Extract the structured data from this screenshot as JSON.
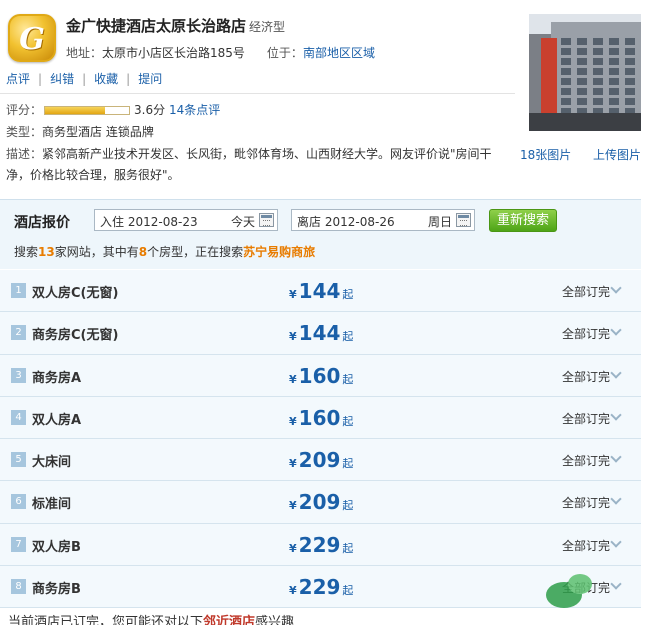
{
  "hotel": {
    "logo_letter": "G",
    "name": "金广快捷酒店太原长治路店",
    "type": "经济型",
    "address_label": "地址：",
    "address": "太原市小店区长治路185号",
    "location_label": "位于：",
    "location": "南部地区区域"
  },
  "actions": [
    "点评",
    "纠错",
    "收藏",
    "提问"
  ],
  "rating": {
    "label": "评分：",
    "score": "3.6分",
    "score_fraction": 0.72,
    "reviews": "14条点评"
  },
  "category": {
    "label": "类型：",
    "value": "商务型酒店 连锁品牌"
  },
  "description": {
    "label": "描述：",
    "text": "紧邻高新产业技术开发区、长风街，毗邻体育场、山西财经大学。网友评价说\"房间干净，价格比较合理，服务很好\"。"
  },
  "photos": {
    "count_link": "18张图片",
    "upload_link": "上传图片"
  },
  "search": {
    "title": "酒店报价",
    "checkin_label": "入住",
    "checkin_date": "2012-08-23",
    "checkin_day": "今天",
    "checkout_label": "离店",
    "checkout_date": "2012-08-26",
    "checkout_day": "周日",
    "button": "重新搜索",
    "status_prefix": "搜索",
    "site_count": "13",
    "status_mid1": "家网站，其中有",
    "room_count": "8",
    "status_mid2": "个房型，正在搜索",
    "current_site": "苏宁易购商旅"
  },
  "rooms": [
    {
      "index": "1",
      "name": "双人房C(无窗)",
      "currency": "¥",
      "price": "144",
      "suffix": "起",
      "status": "全部订完"
    },
    {
      "index": "2",
      "name": "商务房C(无窗)",
      "currency": "¥",
      "price": "144",
      "suffix": "起",
      "status": "全部订完"
    },
    {
      "index": "3",
      "name": "商务房A",
      "currency": "¥",
      "price": "160",
      "suffix": "起",
      "status": "全部订完"
    },
    {
      "index": "4",
      "name": "双人房A",
      "currency": "¥",
      "price": "160",
      "suffix": "起",
      "status": "全部订完"
    },
    {
      "index": "5",
      "name": "大床间",
      "currency": "¥",
      "price": "209",
      "suffix": "起",
      "status": "全部订完"
    },
    {
      "index": "6",
      "name": "标准间",
      "currency": "¥",
      "price": "209",
      "suffix": "起",
      "status": "全部订完"
    },
    {
      "index": "7",
      "name": "双人房B",
      "currency": "¥",
      "price": "229",
      "suffix": "起",
      "status": "全部订完"
    },
    {
      "index": "8",
      "name": "商务房B",
      "currency": "¥",
      "price": "229",
      "suffix": "起",
      "status": "全部订完"
    }
  ],
  "notice": {
    "prefix": "当前酒店已订完，您可能还对以下",
    "highlight": "邻近酒店",
    "suffix": "感兴趣"
  },
  "colors": {
    "link": "#1a5fa8",
    "accent_orange": "#e87c00",
    "button_green": "#4ea417",
    "row_bg": "#f3f9fd"
  }
}
